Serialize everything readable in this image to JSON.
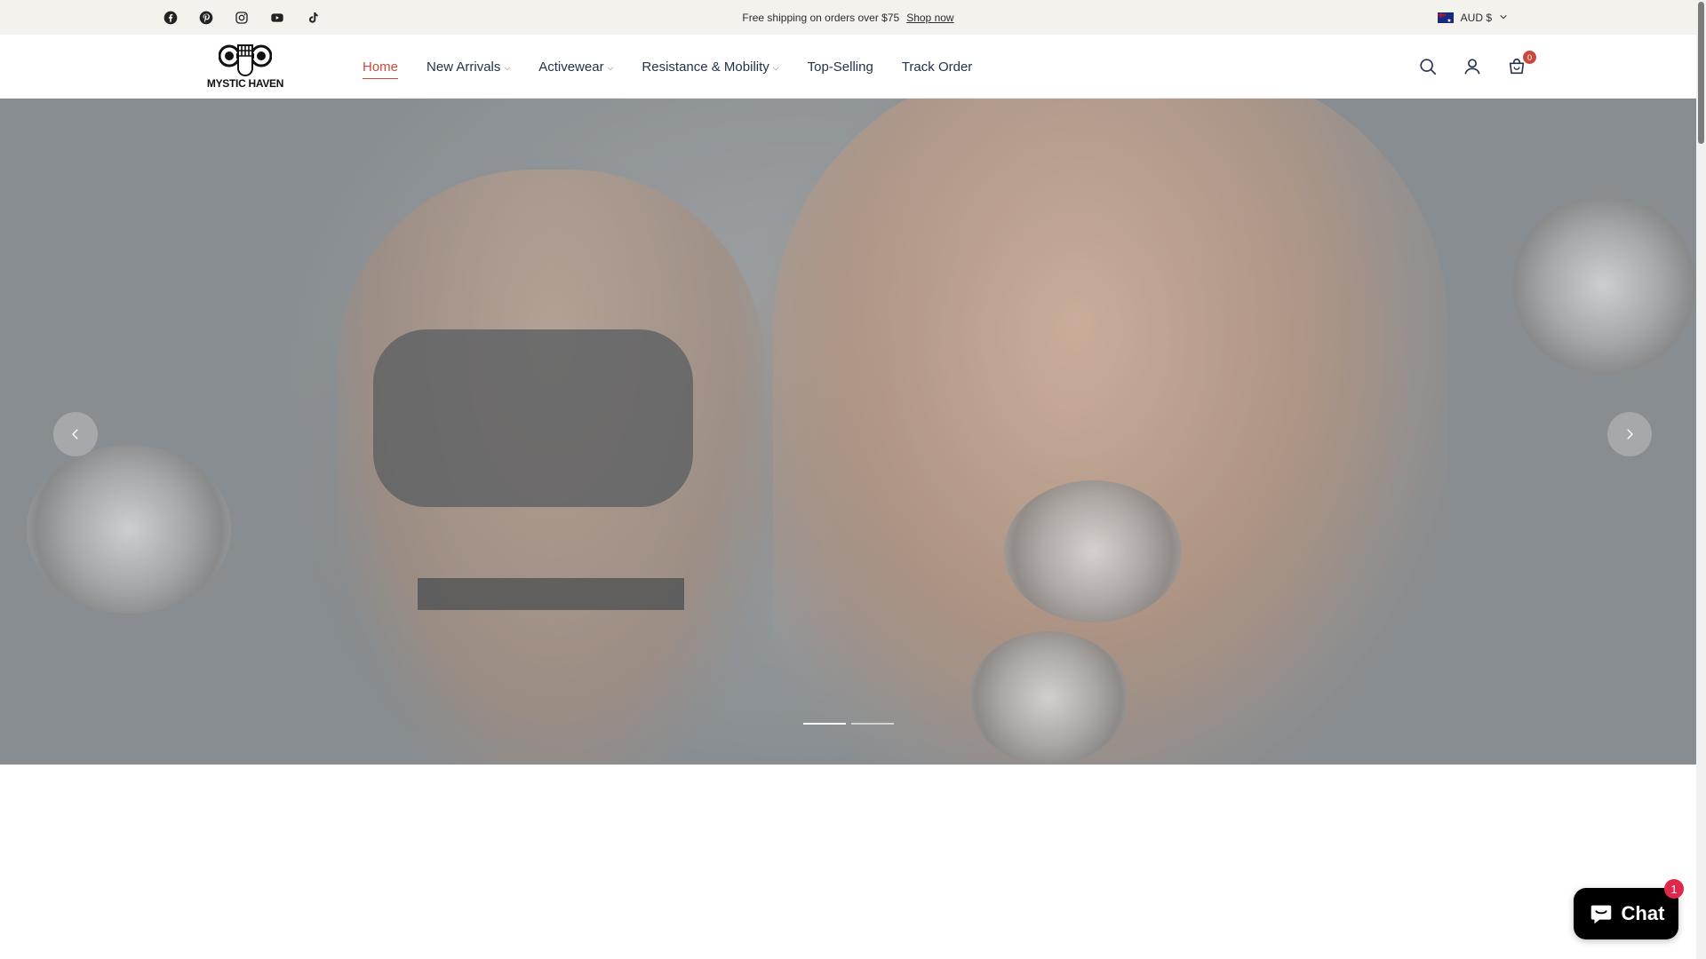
{
  "announcement": {
    "text": "Free shipping on orders over $75",
    "link": "Shop now"
  },
  "socials": [
    "facebook-icon",
    "pinterest-icon",
    "instagram-icon",
    "youtube-icon",
    "tiktok-icon"
  ],
  "currency": {
    "label": "AUD $"
  },
  "logo": {
    "text": "MYSTIC HAVEN"
  },
  "nav": [
    {
      "label": "Home",
      "active": true,
      "dropdown": false
    },
    {
      "label": "New Arrivals",
      "dropdown": true
    },
    {
      "label": "Activewear",
      "dropdown": true
    },
    {
      "label": "Resistance & Mobility",
      "dropdown": true
    },
    {
      "label": "Top-Selling",
      "dropdown": false
    },
    {
      "label": "Track Order",
      "dropdown": false
    }
  ],
  "cart": {
    "count": "0"
  },
  "slider": {
    "slides": 2,
    "current": 1
  },
  "chat": {
    "label": "Chat",
    "unread": "1"
  },
  "colors": {
    "accent": "#c94a3d",
    "topbar": "#f4f2ec",
    "chat": "#000000",
    "chat_badge": "#e0284a"
  }
}
